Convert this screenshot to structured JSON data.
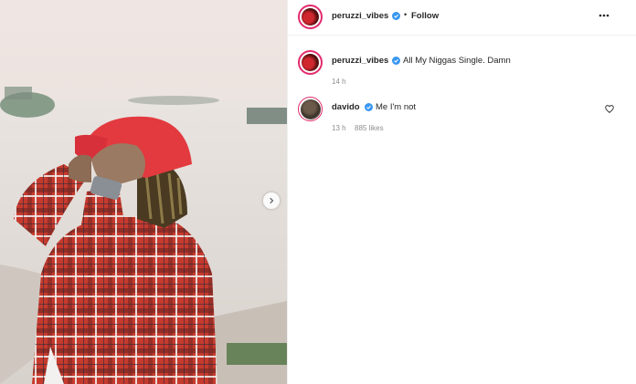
{
  "post": {
    "author": {
      "username": "peruzzi_vibes",
      "verified": true,
      "follow_label": "Follow",
      "separator": "•"
    },
    "caption": {
      "username": "peruzzi_vibes",
      "text": "All My Niggas Single. Damn",
      "time": "14 h"
    },
    "comments": [
      {
        "username": "davido",
        "verified": true,
        "text": "Me I'm not",
        "time": "13 h",
        "likes": "885 likes"
      }
    ],
    "icons": {
      "more": "more-options-icon",
      "verified": "verified-badge-icon",
      "next": "chevron-right-icon",
      "like": "heart-icon"
    },
    "colors": {
      "story_ring": "#e22a6c",
      "verified": "#3897f0",
      "cap": "#e23a3f",
      "shirt_red": "#c63a2e"
    }
  }
}
